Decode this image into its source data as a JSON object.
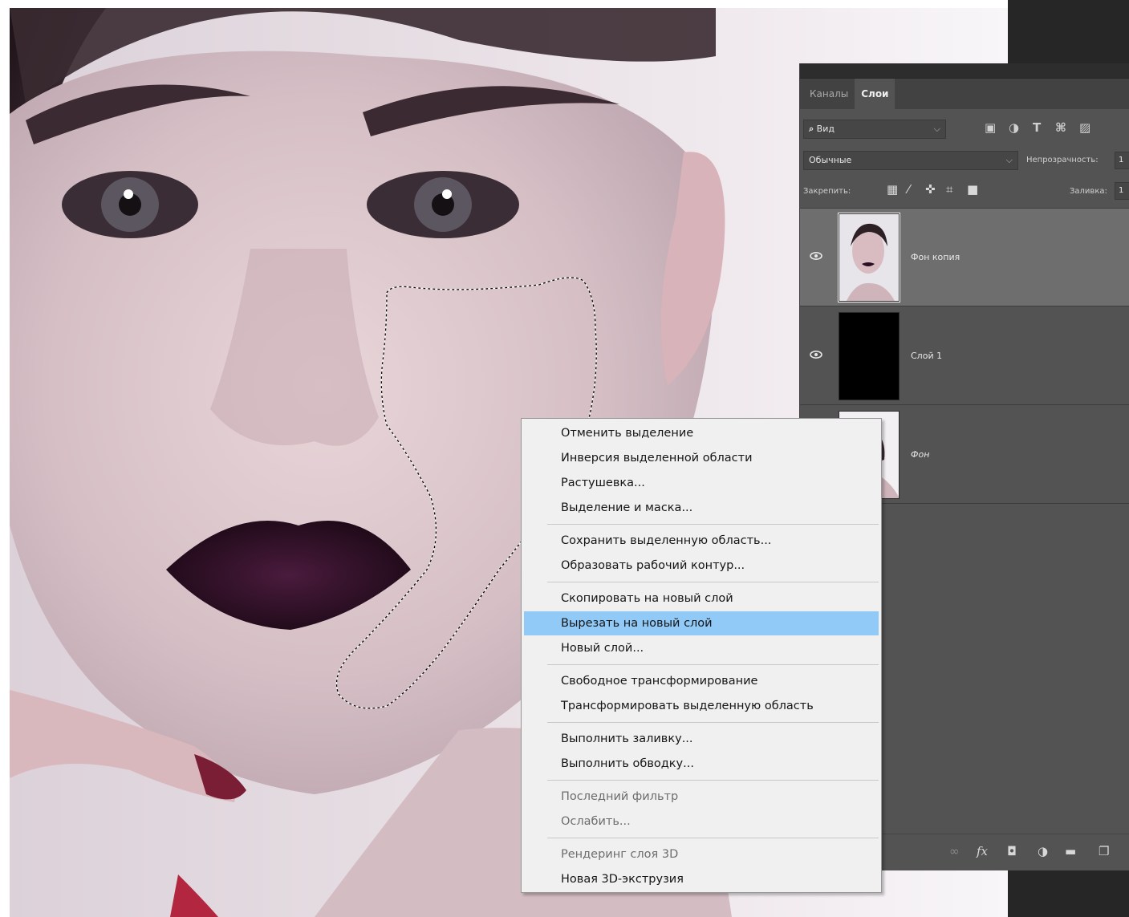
{
  "panel": {
    "tabs": [
      "Каналы",
      "Слои"
    ],
    "filter": {
      "label": "Вид"
    },
    "blend_mode": "Обычные",
    "opacity_label": "Непрозрачность:",
    "opacity_value": "1",
    "lock_label": "Закрепить:",
    "fill_label": "Заливка:",
    "fill_value": "1",
    "layers": [
      {
        "name": "Фон копия",
        "visible": true,
        "selected": true
      },
      {
        "name": "Слой 1",
        "visible": true,
        "selected": false
      },
      {
        "name": "Фон",
        "visible": false,
        "selected": false
      }
    ]
  },
  "context_menu": {
    "items": [
      {
        "label": "Отменить выделение",
        "enabled": true
      },
      {
        "label": "Инверсия выделенной области",
        "enabled": true
      },
      {
        "label": "Растушевка...",
        "enabled": true
      },
      {
        "label": "Выделение и маска...",
        "enabled": true
      },
      {
        "label": "Сохранить выделенную область...",
        "enabled": true
      },
      {
        "label": "Образовать рабочий контур...",
        "enabled": true
      },
      {
        "label": "Скопировать на новый слой",
        "enabled": true
      },
      {
        "label": "Вырезать на новый слой",
        "enabled": true,
        "highlighted": true
      },
      {
        "label": "Новый слой...",
        "enabled": true
      },
      {
        "label": "Свободное трансформирование",
        "enabled": true
      },
      {
        "label": "Трансформировать выделенную область",
        "enabled": true
      },
      {
        "label": "Выполнить заливку...",
        "enabled": true
      },
      {
        "label": "Выполнить обводку...",
        "enabled": true
      },
      {
        "label": "Последний фильтр",
        "enabled": false
      },
      {
        "label": "Ослабить...",
        "enabled": false
      },
      {
        "label": "Рендеринг слоя 3D",
        "enabled": false
      },
      {
        "label": "Новая 3D-экструзия",
        "enabled": true
      }
    ]
  },
  "colors": {
    "panel_bg": "#535353",
    "selected_layer": "#6e6e6e",
    "menu_bg": "#f0f0f0",
    "menu_highlight": "#91c9f7",
    "lips": "#2a0f24"
  },
  "icons": {
    "filter": "search-icon",
    "filter_types": [
      "image-filter-icon",
      "adjustment-filter-icon",
      "type-filter-icon",
      "shape-filter-icon",
      "smart-object-filter-icon"
    ],
    "lock": [
      "lock-transparent-icon",
      "lock-brush-icon",
      "lock-move-icon",
      "lock-artboard-icon",
      "lock-all-icon"
    ],
    "bottom": [
      "link-icon",
      "fx-icon",
      "mask-icon",
      "adjustment-icon",
      "folder-icon",
      "new-layer-icon"
    ]
  }
}
